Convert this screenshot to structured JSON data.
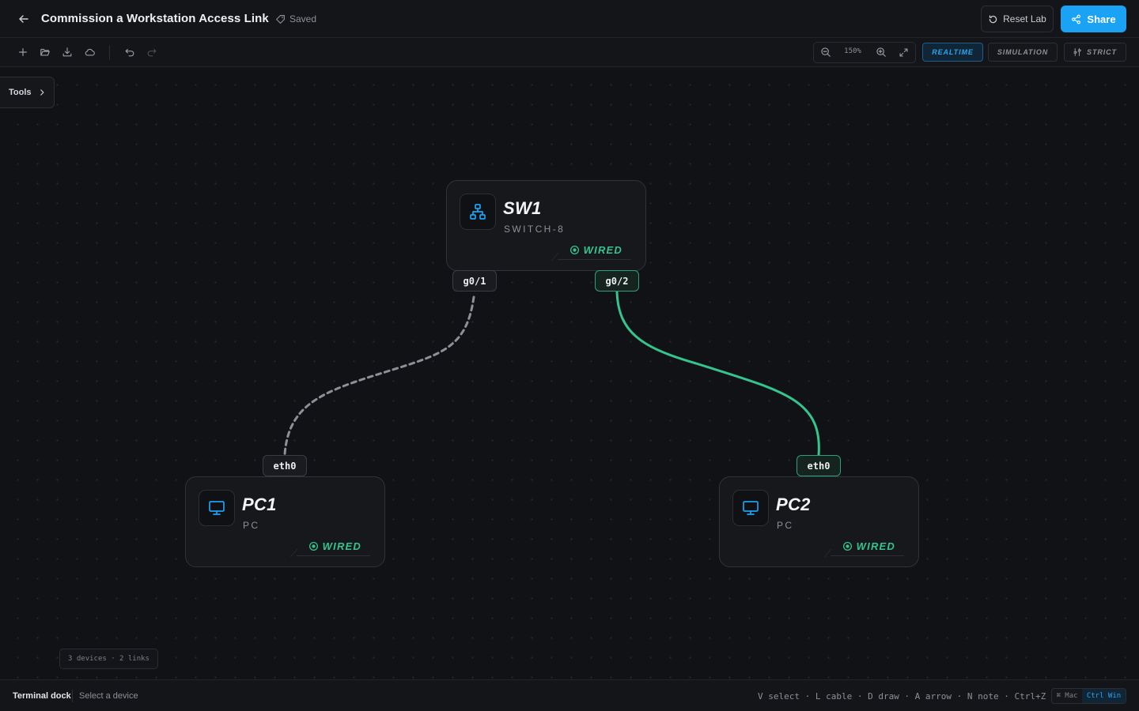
{
  "header": {
    "title": "Commission a Workstation Access Link",
    "saved_label": "Saved",
    "reset_label": "Reset Lab",
    "share_label": "Share"
  },
  "toolbar": {
    "zoom_level": "150%",
    "modes": {
      "realtime": "REALTIME",
      "simulation": "SIMULATION",
      "strict": "STRICT"
    },
    "active_mode": "REALTIME"
  },
  "canvas": {
    "tools_label": "Tools",
    "stats": "3 devices · 2 links"
  },
  "devices": {
    "sw1": {
      "name": "SW1",
      "type": "SWITCH-8",
      "status": "WIRED",
      "icon": "network-switch-icon"
    },
    "pc1": {
      "name": "PC1",
      "type": "PC",
      "status": "WIRED",
      "icon": "monitor-icon"
    },
    "pc2": {
      "name": "PC2",
      "type": "PC",
      "status": "WIRED",
      "icon": "monitor-icon"
    }
  },
  "ports": {
    "sw1_g01": "g0/1",
    "sw1_g02": "g0/2",
    "pc1_eth0": "eth0",
    "pc2_eth0": "eth0"
  },
  "links": [
    {
      "from": "SW1 g0/1",
      "to": "PC1 eth0",
      "state": "pending"
    },
    {
      "from": "SW1 g0/2",
      "to": "PC2 eth0",
      "state": "up"
    }
  ],
  "footer": {
    "dock_label": "Terminal dock",
    "dock_hint": "Select a device",
    "shortcuts": "V select · L cable · D draw · A arrow · N note · Ctrl+Z undo",
    "os_mac": "⌘ Mac",
    "os_win": "Ctrl Win"
  },
  "colors": {
    "accent": "#1aa3f5",
    "link_up": "#35c48d",
    "link_pending": "#8d9099",
    "background": "#111216"
  }
}
